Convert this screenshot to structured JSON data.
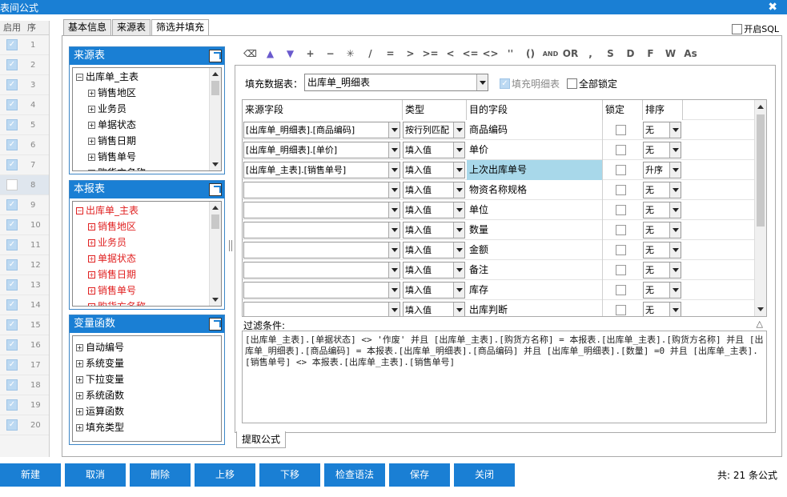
{
  "window": {
    "title": "表间公式",
    "close_glyph": "✖"
  },
  "left_list": {
    "headers": [
      "启用",
      "序"
    ],
    "rows": [
      {
        "on": true,
        "num": "1"
      },
      {
        "on": true,
        "num": "2"
      },
      {
        "on": true,
        "num": "3"
      },
      {
        "on": true,
        "num": "4"
      },
      {
        "on": true,
        "num": "5"
      },
      {
        "on": true,
        "num": "6"
      },
      {
        "on": true,
        "num": "7"
      },
      {
        "on": false,
        "num": "8"
      },
      {
        "on": true,
        "num": "9"
      },
      {
        "on": true,
        "num": "10"
      },
      {
        "on": true,
        "num": "11"
      },
      {
        "on": true,
        "num": "12"
      },
      {
        "on": true,
        "num": "13"
      },
      {
        "on": true,
        "num": "14"
      },
      {
        "on": true,
        "num": "15"
      },
      {
        "on": true,
        "num": "16"
      },
      {
        "on": true,
        "num": "17"
      },
      {
        "on": true,
        "num": "18"
      },
      {
        "on": true,
        "num": "19"
      },
      {
        "on": true,
        "num": "20"
      }
    ]
  },
  "tabs": [
    "基本信息",
    "来源表",
    "筛选并填充"
  ],
  "sql_toggle": "开启SQL",
  "panels": {
    "source": {
      "title": "来源表",
      "items": [
        {
          "label": "出库单_主表",
          "sign": "⊟",
          "level": 0
        },
        {
          "label": "销售地区",
          "sign": "⊞",
          "level": 1
        },
        {
          "label": "业务员",
          "sign": "⊞",
          "level": 1
        },
        {
          "label": "单据状态",
          "sign": "⊞",
          "level": 1
        },
        {
          "label": "销售日期",
          "sign": "⊞",
          "level": 1
        },
        {
          "label": "销售单号",
          "sign": "⊞",
          "level": 1
        },
        {
          "label": "购货方名称",
          "sign": "⊞",
          "level": 1
        }
      ]
    },
    "current": {
      "title": "本报表",
      "items": [
        {
          "label": "出库单_主表",
          "sign": "⊟",
          "level": 0
        },
        {
          "label": "销售地区",
          "sign": "⊞",
          "level": 1
        },
        {
          "label": "业务员",
          "sign": "⊞",
          "level": 1
        },
        {
          "label": "单据状态",
          "sign": "⊞",
          "level": 1
        },
        {
          "label": "销售日期",
          "sign": "⊞",
          "level": 1
        },
        {
          "label": "销售单号",
          "sign": "⊞",
          "level": 1
        },
        {
          "label": "购货方名称",
          "sign": "⊞",
          "level": 1
        }
      ]
    },
    "funcs": {
      "title": "变量函数",
      "items": [
        {
          "label": "自动编号",
          "sign": "⊞",
          "level": 0
        },
        {
          "label": "系统变量",
          "sign": "⊞",
          "level": 0
        },
        {
          "label": "下拉变量",
          "sign": "⊞",
          "level": 0
        },
        {
          "label": "系统函数",
          "sign": "⊞",
          "level": 0
        },
        {
          "label": "运算函数",
          "sign": "⊞",
          "level": 0
        },
        {
          "label": "填充类型",
          "sign": "⊞",
          "level": 0
        }
      ]
    }
  },
  "toolbar": [
    "⌫",
    "▲",
    "▼",
    "+",
    "−",
    "✳",
    "/",
    "=",
    ">",
    ">=",
    "<",
    "<=",
    "<>",
    "''",
    "()",
    "AND",
    "OR",
    ",",
    "S",
    "D",
    "F",
    "W",
    "As"
  ],
  "fill": {
    "label": "填充数据表：",
    "value": "出库单_明细表",
    "detail_label": "填充明细表",
    "lock_all_label": "全部锁定"
  },
  "grid": {
    "headers": [
      "来源字段",
      "类型",
      "目的字段",
      "锁定",
      "排序"
    ],
    "rows": [
      {
        "src": "[出库单_明细表].[商品编码]",
        "type": "按行列匹配",
        "dest": "商品编码",
        "sort": "无",
        "hl": false
      },
      {
        "src": "[出库单_明细表].[单价]",
        "type": "填入值",
        "dest": "单价",
        "sort": "无",
        "hl": false
      },
      {
        "src": "[出库单_主表].[销售单号]",
        "type": "填入值",
        "dest": "上次出库单号",
        "sort": "升序",
        "hl": true
      },
      {
        "src": "",
        "type": "填入值",
        "dest": "物资名称规格",
        "sort": "无",
        "hl": false
      },
      {
        "src": "",
        "type": "填入值",
        "dest": "单位",
        "sort": "无",
        "hl": false
      },
      {
        "src": "",
        "type": "填入值",
        "dest": "数量",
        "sort": "无",
        "hl": false
      },
      {
        "src": "",
        "type": "填入值",
        "dest": "金额",
        "sort": "无",
        "hl": false
      },
      {
        "src": "",
        "type": "填入值",
        "dest": "备注",
        "sort": "无",
        "hl": false
      },
      {
        "src": "",
        "type": "填入值",
        "dest": "库存",
        "sort": "无",
        "hl": false
      },
      {
        "src": "",
        "type": "填入值",
        "dest": "出库判断",
        "sort": "无",
        "hl": false
      }
    ]
  },
  "filter": {
    "label": "过滤条件:",
    "text": "[出库单_主表].[单据状态] <> '作废' 并且 [出库单_主表].[购货方名称] = 本报表.[出库单_主表].[购货方名称] 并且 [出库单_明细表].[商品编码] = 本报表.[出库单_明细表].[商品编码] 并且 [出库单_明细表].[数量] =0 并且 [出库单_主表].[销售单号] <> 本报表.[出库单_主表].[销售单号]"
  },
  "subtab": "提取公式",
  "buttons": [
    "新建",
    "取消",
    "删除",
    "上移",
    "下移",
    "检查语法",
    "保存",
    "关闭"
  ],
  "total": "共: 21 条公式",
  "colors": {
    "accent": "#1a7fd4",
    "highlight": "#a8d8ea",
    "current_tree": "#e02020"
  }
}
